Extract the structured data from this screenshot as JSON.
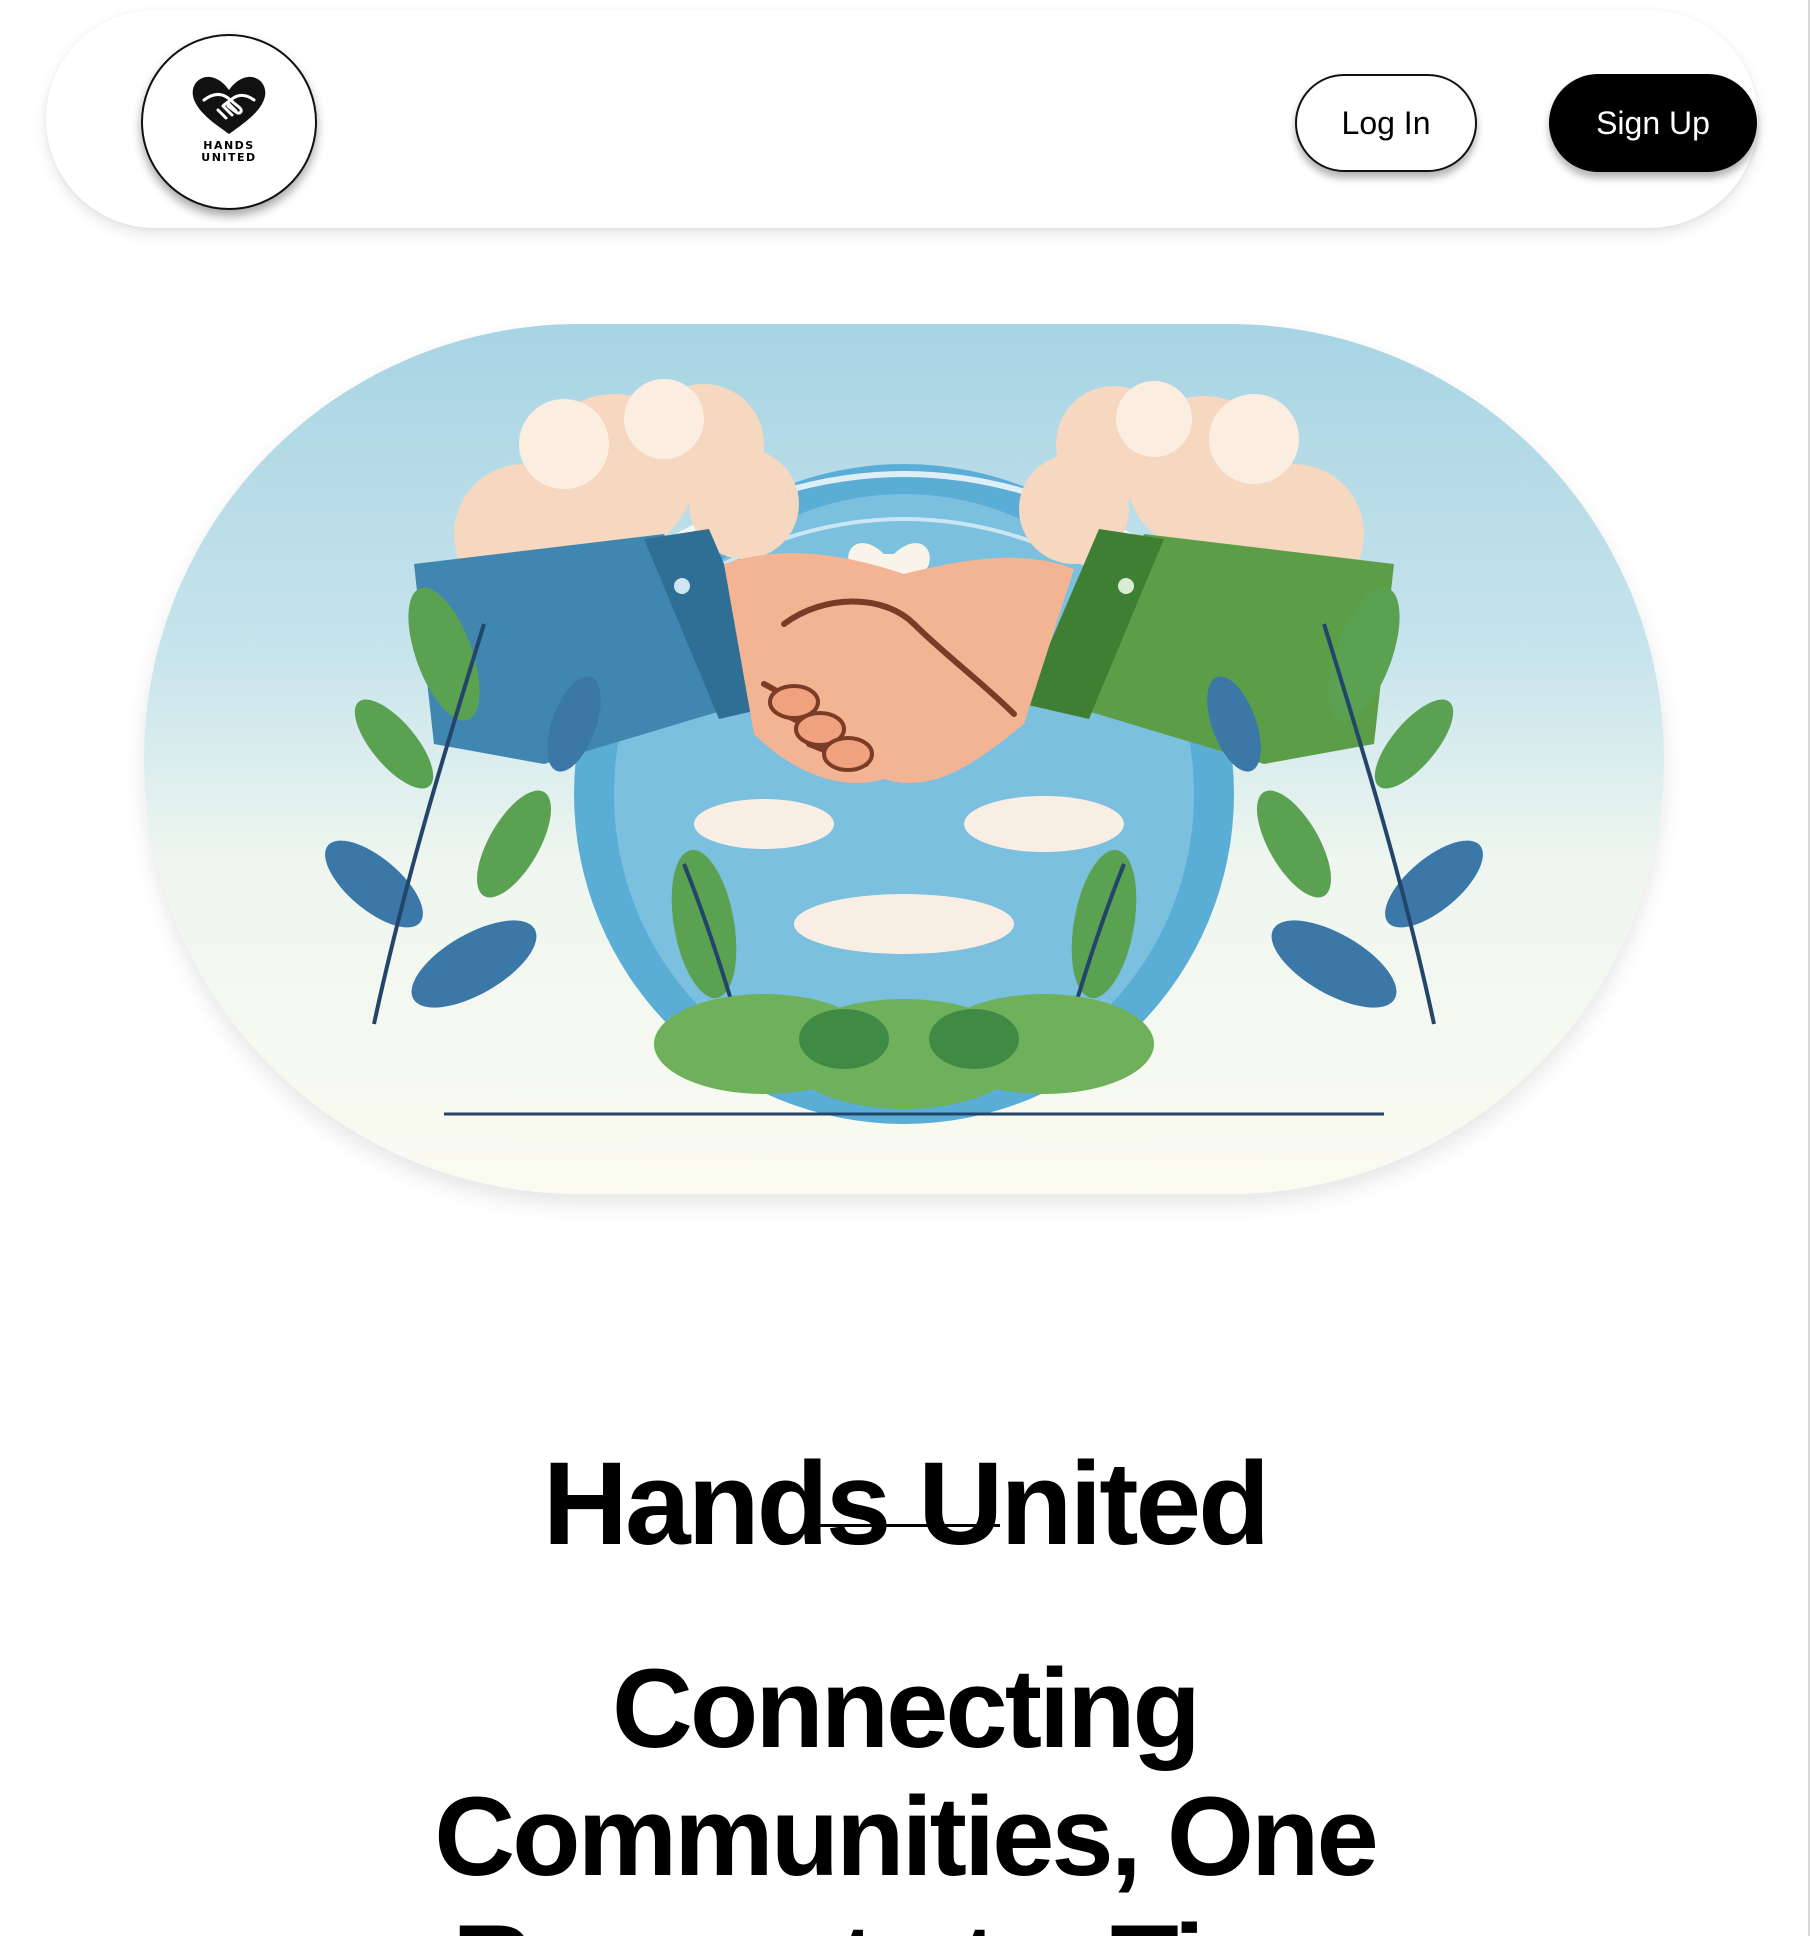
{
  "header": {
    "logo_text_line1": "HANDS",
    "logo_text_line2": "UNITED",
    "login_label": "Log In",
    "signup_label": "Sign Up"
  },
  "hero": {
    "image": "handshake-illustration"
  },
  "main": {
    "title": "Hands United",
    "tagline": "Connecting Communities, One Request at a Time"
  },
  "colors": {
    "sky": "#a8d4e4",
    "sleeve_left": "#3f86b0",
    "sleeve_right": "#5c9e48",
    "skin": "#f3b493",
    "leaf_green": "#5aa152",
    "leaf_blue": "#3b78a8",
    "button_dark": "#000000"
  }
}
